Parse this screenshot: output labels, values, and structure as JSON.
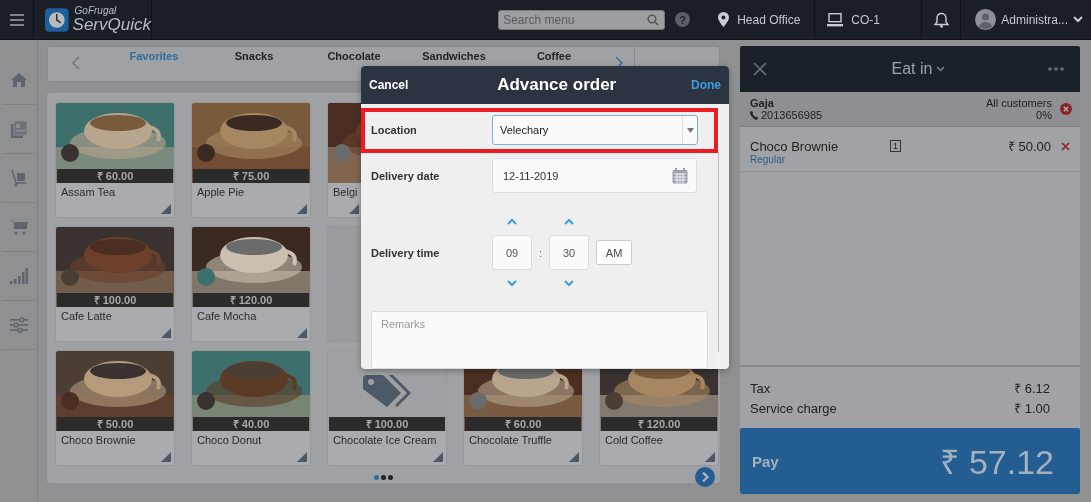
{
  "topbar": {
    "brand_small": "GoFrugal",
    "brand": "ServQuick",
    "search": {
      "placeholder": "Search menu"
    },
    "help": "?",
    "location": "Head Office",
    "counter": "CO-1",
    "user": "Administra..."
  },
  "tabs": [
    {
      "label": "Favorites",
      "selected": true
    },
    {
      "label": "Snacks",
      "selected": false
    },
    {
      "label": "Chocolate",
      "selected": false
    },
    {
      "label": "Sandwiches",
      "selected": false
    },
    {
      "label": "Coffee",
      "selected": false
    }
  ],
  "products": [
    [
      {
        "name": "Assam Tea",
        "price": "₹ 60.00"
      },
      {
        "name": "Apple Pie",
        "price": "₹ 75.00"
      },
      {
        "name": "Belgi"
      }
    ],
    [
      {
        "name": "Cafe Latte",
        "price": "₹ 100.00"
      },
      {
        "name": "Cafe Mocha",
        "price": "₹ 120.00"
      },
      {
        "kind": "empty"
      }
    ],
    [
      {
        "name": "Choco Brownie",
        "price": "₹ 50.00"
      },
      {
        "name": "Choco Donut",
        "price": "₹ 40.00"
      },
      {
        "kind": "placeholder",
        "name": "Chocolate Ice Cream",
        "price": "₹ 100.00"
      },
      {
        "name": "Chocolate Truffle",
        "price": "₹ 60.00"
      },
      {
        "name": "Cold Coffee",
        "price": "₹ 120.00"
      }
    ]
  ],
  "pager": [
    {
      "selected": true
    },
    {
      "selected": false
    },
    {
      "selected": false
    }
  ],
  "dialog": {
    "cancel": "Cancel",
    "title": "Advance order",
    "done": "Done",
    "location": {
      "label": "Location",
      "value": "Velechary",
      "highlighted": true
    },
    "delivery_date": {
      "label": "Delivery date",
      "value": "12-11-2019"
    },
    "delivery_time": {
      "label": "Delivery time",
      "hour": "09",
      "separator": ":",
      "minute": "30",
      "period": "AM"
    },
    "remarks": {
      "placeholder": "Remarks"
    }
  },
  "order": {
    "mode": "Eat in",
    "customer": {
      "name": "Gaja",
      "phone": "2013656985",
      "group": "All customers",
      "discount": "0%"
    },
    "items": [
      {
        "name": "Choco Brownie",
        "variant": "Regular",
        "qty": "1",
        "amount": "₹ 50.00"
      }
    ],
    "charges": [
      {
        "label": "Tax",
        "amount": "₹ 6.12"
      },
      {
        "label": "Service charge",
        "amount": "₹ 1.00"
      }
    ],
    "pay": {
      "label": "Pay",
      "amount": "₹ 57.12"
    }
  }
}
